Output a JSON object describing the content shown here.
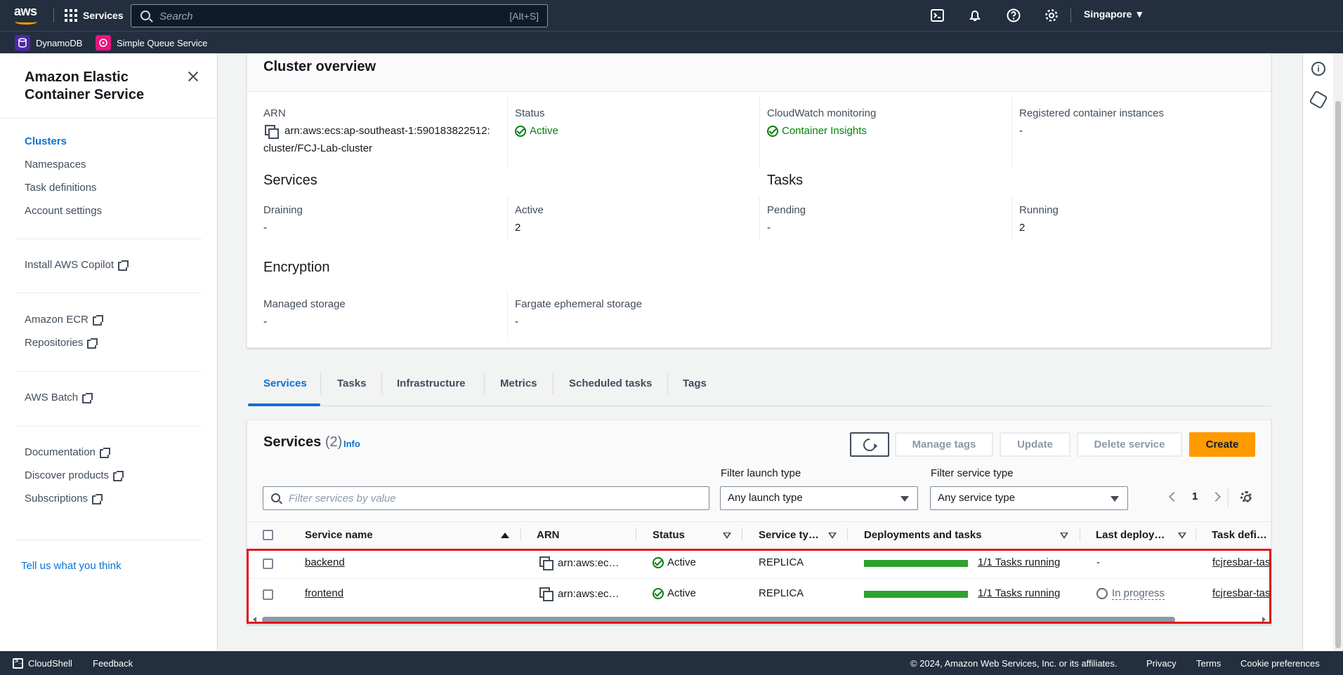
{
  "topnav": {
    "services_label": "Services",
    "search_placeholder": "Search",
    "search_shortcut": "[Alt+S]",
    "region": "Singapore ▼",
    "favorites": [
      {
        "label": "DynamoDB",
        "icon": "dynamodb-icon",
        "color": "#4d27aa"
      },
      {
        "label": "Simple Queue Service",
        "icon": "sqs-icon",
        "color": "#e7157b"
      }
    ]
  },
  "sidebar": {
    "title": "Amazon Elastic Container Service",
    "nav": [
      "Clusters",
      "Namespaces",
      "Task definitions",
      "Account settings"
    ],
    "external": [
      "Install AWS Copilot",
      "Amazon ECR",
      "Repositories",
      "AWS Batch",
      "Documentation",
      "Discover products",
      "Subscriptions"
    ],
    "feedback": "Tell us what you think"
  },
  "overview": {
    "title": "Cluster overview",
    "arn_label": "ARN",
    "arn_line1": "arn:aws:ecs:ap-southeast-1:590183822512:",
    "arn_line2": "cluster/FCJ-Lab-cluster",
    "status_label": "Status",
    "status_value": "Active",
    "cw_label": "CloudWatch monitoring",
    "cw_value": "Container Insights",
    "reg_label": "Registered container instances",
    "reg_value": "-",
    "services_heading": "Services",
    "draining_label": "Draining",
    "draining_value": "-",
    "active_label": "Active",
    "active_value": "2",
    "tasks_heading": "Tasks",
    "pending_label": "Pending",
    "pending_value": "-",
    "running_label": "Running",
    "running_value": "2",
    "encryption_heading": "Encryption",
    "managed_label": "Managed storage",
    "managed_value": "-",
    "fargate_label": "Fargate ephemeral storage",
    "fargate_value": "-"
  },
  "tabs": [
    "Services",
    "Tasks",
    "Infrastructure",
    "Metrics",
    "Scheduled tasks",
    "Tags"
  ],
  "services_panel": {
    "title": "Services",
    "count": "(2)",
    "info": "Info",
    "buttons": {
      "manage_tags": "Manage tags",
      "update": "Update",
      "delete": "Delete service",
      "create": "Create"
    },
    "filter_placeholder": "Filter services by value",
    "launch_label": "Filter launch type",
    "launch_value": "Any launch type",
    "service_type_label": "Filter service type",
    "service_type_value": "Any service type",
    "page": "1",
    "columns": [
      "Service name",
      "ARN",
      "Status",
      "Service ty…",
      "Deployments and tasks",
      "Last deploy…",
      "Task defi…"
    ],
    "rows": [
      {
        "name": "backend",
        "arn": "arn:aws:ec…",
        "status": "Active",
        "type": "REPLICA",
        "deploy_progress": 1.0,
        "tasks": "1/1 Tasks running",
        "last_deploy": "-",
        "taskdef": "fcjresbar-tas"
      },
      {
        "name": "frontend",
        "arn": "arn:aws:ec…",
        "status": "Active",
        "type": "REPLICA",
        "deploy_progress": 1.0,
        "tasks": "1/1 Tasks running",
        "last_deploy": "In progress",
        "taskdef": "fcjresbar-tas"
      }
    ]
  },
  "footer": {
    "cloudshell": "CloudShell",
    "feedback": "Feedback",
    "copyright": "© 2024, Amazon Web Services, Inc. or its affiliates.",
    "privacy": "Privacy",
    "terms": "Terms",
    "cookies": "Cookie preferences"
  }
}
